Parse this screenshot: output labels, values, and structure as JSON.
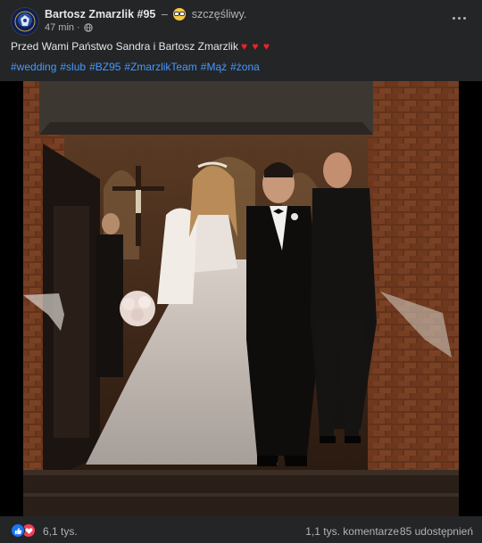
{
  "post": {
    "author": "Bartosz Zmarzlik #95",
    "feeling_separator": "–",
    "feeling_emoji": "smiling-face-with-sunglasses",
    "feeling": "szczęśliwy.",
    "time": "47 min",
    "time_separator": "·",
    "privacy_icon": "globe-icon",
    "caption": "Przed Wami Państwo Sandra i Bartosz Zmarzlik",
    "caption_hearts": "♥ ♥ ♥",
    "hashtags": [
      "#wedding",
      "#slub",
      "#BZ95",
      "#ZmarzlikTeam",
      "#Mąż",
      "#żona"
    ]
  },
  "photo": {
    "description_icon": "wedding-photo"
  },
  "footer": {
    "reaction_icons": [
      "like-icon",
      "love-icon"
    ],
    "reaction_count": "6,1 tys.",
    "comments": "1,1 tys. komentarze",
    "shares": "85 udostępnień"
  },
  "colors": {
    "background": "#242526",
    "text": "#e4e6eb",
    "secondary_text": "#b0b3b8",
    "link": "#4599ff",
    "like": "#1877f2",
    "love": "#f33e58",
    "heart": "#e8252b"
  }
}
